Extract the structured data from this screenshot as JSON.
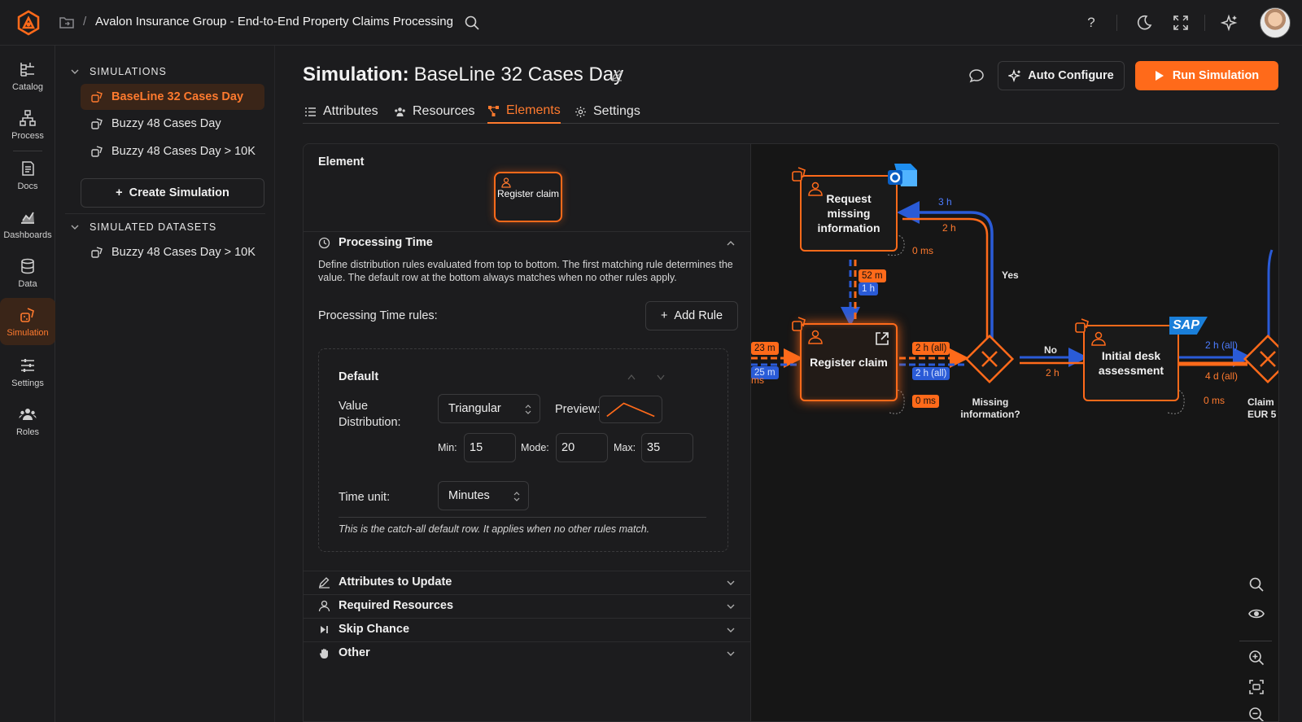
{
  "header": {
    "project_title": "Avalon Insurance Group - End-to-End Property Claims Processing",
    "breadcrumb_sep": "/"
  },
  "rail": [
    {
      "label": "Catalog",
      "icon": "catalog-icon"
    },
    {
      "label": "Process",
      "icon": "process-icon"
    },
    {
      "label": "Docs",
      "icon": "docs-icon"
    },
    {
      "label": "Dashboards",
      "icon": "dashboards-icon"
    },
    {
      "label": "Data",
      "icon": "database-icon"
    },
    {
      "label": "Simulation",
      "icon": "simulation-icon",
      "active": true
    },
    {
      "label": "Settings",
      "icon": "sliders-icon"
    },
    {
      "label": "Roles",
      "icon": "roles-icon"
    }
  ],
  "simulations": {
    "heading": "SIMULATIONS",
    "items": [
      "BaseLine 32 Cases Day",
      "Buzzy 48 Cases Day",
      "Buzzy 48 Cases Day > 10K"
    ],
    "create_label": "Create Simulation"
  },
  "datasets": {
    "heading": "SIMULATED DATASETS",
    "items": [
      "Buzzy 48 Cases Day > 10K"
    ]
  },
  "main": {
    "title_prefix": "Simulation:",
    "title_name": "BaseLine 32 Cases Day",
    "auto_configure": "Auto Configure",
    "run_simulation": "Run Simulation",
    "tabs": [
      "Attributes",
      "Resources",
      "Elements",
      "Settings"
    ],
    "active_tab": "Elements"
  },
  "element_panel": {
    "label": "Element",
    "chip": "Register claim",
    "processing_time": {
      "title": "Processing Time",
      "description": "Define distribution rules evaluated from top to bottom. The first matching rule determines the value. The default row at the bottom always matches when no other rules apply.",
      "rules_label": "Processing Time rules:",
      "add_rule": "Add Rule",
      "rule": {
        "title": "Default",
        "value_distribution_label": "Value Distribution:",
        "distribution": "Triangular",
        "preview_label": "Preview:",
        "min_label": "Min:",
        "min": "15",
        "mode_label": "Mode:",
        "mode": "20",
        "max_label": "Max:",
        "max": "35",
        "time_unit_label": "Time unit:",
        "time_unit": "Minutes",
        "note": "This is the catch-all default row. It applies when no other rules match."
      }
    },
    "sections": [
      "Attributes to Update",
      "Required Resources",
      "Skip Chance",
      "Other"
    ]
  },
  "canvas": {
    "nodes": {
      "request": "Request missing information",
      "register": "Register claim",
      "initial": "Initial desk assessment",
      "gateway": "Missing information?",
      "claim_cut": "Claim EUR 5"
    },
    "labels": {
      "yes": "Yes",
      "no": "No",
      "b_3h": "3 h",
      "o_2h_top": "2 h",
      "o_0ms_top": "0 ms",
      "o_52m": "52 m",
      "b_1h": "1 h",
      "o_23m": "23 m",
      "b_25m": "25 m",
      "ms_cut": "ms",
      "o_2h_all": "2 h (all)",
      "b_2h_all": "2 h (all)",
      "o_0ms_mid": "0 ms",
      "o_2h_no": "2 h",
      "b_2h_all_right": "2 h (all)",
      "o_4d_all": "4 d (all)",
      "o_0ms_right": "0 ms",
      "sap": "SAP"
    },
    "colors": {
      "accent": "#ff6a1a",
      "blue": "#2a5bd7"
    }
  }
}
